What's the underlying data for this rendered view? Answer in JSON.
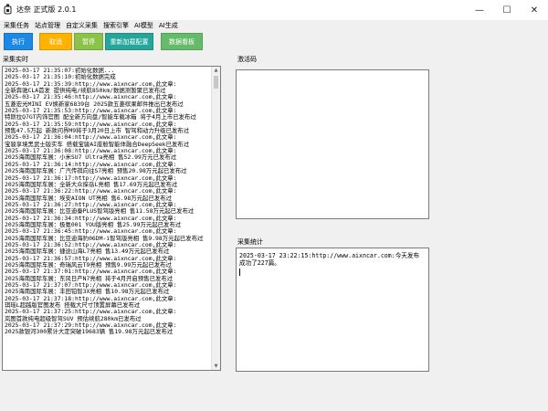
{
  "window": {
    "title": "达奈 正式版 2.0.1",
    "minimize": "—",
    "maximize": "☐",
    "close": "✕"
  },
  "menu": [
    "采集任务",
    "站点管理",
    "自定义采集",
    "搜索引擎",
    "AI模型",
    "AI生成"
  ],
  "toolbar": {
    "buttons": [
      {
        "label": "执行",
        "color": "#1e88e5"
      },
      {
        "label": "取消",
        "color": "#ffb300"
      },
      {
        "label": "暂停",
        "color": "#8bc34a"
      },
      {
        "label": "重新加载配置",
        "color": "#26a69a"
      },
      {
        "label": "数据看板",
        "color": "#66bb6a"
      }
    ]
  },
  "left_panel": {
    "label": "采集实时",
    "lines": [
      "2025-03-17 21:35:07:初始化数据...",
      "2025-03-17 21:35:10:初始化数据完成",
      "2025-03-17 21:35:39:http://www.aixncar.com,此文章:",
      "全新奔驰CLA首发 提供纯电/续航850km/数据测暂聚已发布过",
      "2025-03-17 21:35:46:http://www.aixncar.com,此文章:",
      "五菱宏光MINI EV焕新家6839台 2025款五菱缤果邮件推出已发布过",
      "2025-03-17 21:35:53:http://www.aixncar.com,此文章:",
      "特斯拉Q7GT内饰官图 配全新方向盘/智能车载冰箱 将于4月上市已发布过",
      "2025-03-17 21:35:59:http://www.aixncar.com,此文章:",
      "预售47.5万起 新款问界M9将于3月20日上市 智驾和动力升级已发布过",
      "2025-03-17 21:36:04:http://www.aixncar.com,此文章:",
      "宝骏享境黑武士版实车 搭载宝骏AI座舱智能体融合DeepSeek已发布过",
      "2025-03-17 21:36:08:http://www.aixncar.com,此文章:",
      "2025海南国际车展：小米SU7 Ultra亮相 售52.99万元已发布过",
      "2025-03-17 21:36:14:http://www.aixncar.com,此文章:",
      "2025海南国际车展：广汽传祺向往S7亮相 预售20.98万元起已发布过",
      "2025-03-17 21:36:17:http://www.aixncar.com,此文章:",
      "2025海南国际车展：全新大众探岳L亮相 售17.69万元起已发布过",
      "2025-03-17 21:36:22:http://www.aixncar.com,此文章:",
      "2025海南国际车展：埃安AION UT亮相 售6.98万元起已发布过",
      "2025-03-17 21:36:27:http://www.aixncar.com,此文章:",
      "2025海南国际车展：比亚迪秦PLUS智驾版亮相 售11.58万元起已发布过",
      "2025-03-17 21:36:34:http://www.aixncar.com,此文章:",
      "2025海南国际车展：极氪001 YOU版亮相 售25.99万元起已发布过",
      "2025-03-17 21:36:45:http://www.aixncar.com,此文章:",
      "2025海南国际车展：比亚迪海豹06DM-i智驾版亮相 售9.98万元起已发布过",
      "2025-03-17 21:36:52:http://www.aixncar.com,此文章:",
      "2025海南国际车展：捷途山海L7亮相 售13.49万元起已发布过",
      "2025-03-17 21:36:57:http://www.aixncar.com,此文章:",
      "2025海南国际车展：奇瑞风云T9亮相 预售9.99万元起已发布过",
      "2025-03-17 21:37:01:http://www.aixncar.com,此文章:",
      "2025海南国际车展：东风日产N7亮相 将于4月开启预售已发布过",
      "2025-03-17 21:37:07:http://www.aixncar.com,此文章:",
      "2025海南国际车展：丰田铂智3X亮相 售10.98万元起已发布过",
      "2025-03-17 21:37:18:http://www.aixncar.com,此文章:",
      "琪瑶L超越版官图发布 搭载大尺寸顶置屏幕已发布过",
      "2025-03-17 21:37:25:http://www.aixncar.com,此文章:",
      "岚图首款纯电超级智驾SUV 预估续航280km已发布过",
      "2025-03-17 21:37:29:http://www.aixncar.com,此文章:",
      "2025款银河300累计大定突破19683辆 售19.98万元起已发布过"
    ]
  },
  "right_top": {
    "label": "激活码",
    "value": ""
  },
  "right_bottom": {
    "label": "采集统计",
    "value": "2025-03-17 23:22:15:http://www.aixncar.com:今天发布成功了227篇。"
  }
}
